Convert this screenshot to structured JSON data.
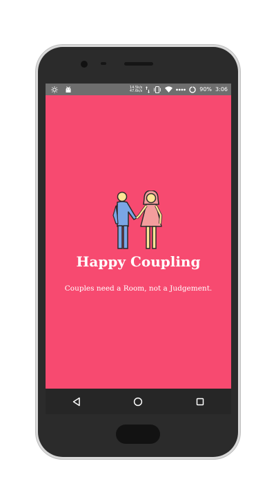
{
  "status_bar": {
    "net_speed_up": "14.5k/s",
    "net_speed_down": "47.6k/s",
    "battery": "90%",
    "time": "3:06",
    "icons": [
      "brightness-icon",
      "android-debug-icon",
      "data-transfer-icon",
      "vibrate-icon",
      "wifi-icon",
      "signal-icon",
      "battery-icon"
    ]
  },
  "splash": {
    "title": "Happy Coupling",
    "tagline": "Couples need a Room, not a Judgement.",
    "logo": "couple-holding-hands-icon",
    "background_color": "#f74a70"
  },
  "nav_bar": {
    "back": "back-icon",
    "home": "home-icon",
    "recents": "recents-icon"
  }
}
